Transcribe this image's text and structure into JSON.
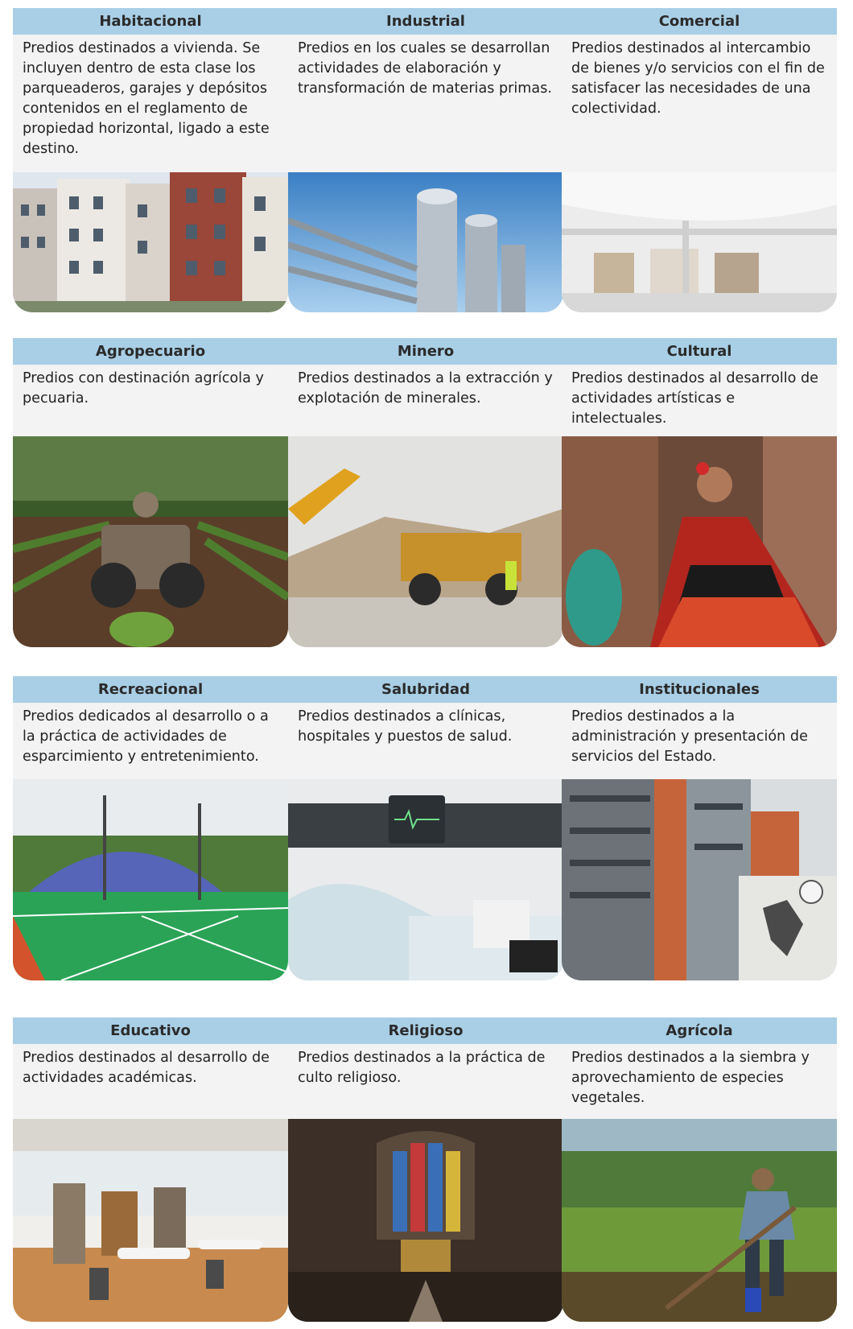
{
  "cards": [
    {
      "title": "Habitacional",
      "description": "Predios destinados a vivienda. Se incluyen dentro de esta clase los parqueaderos, garajes y depósitos contenidos en el reglamento de propiedad horizontal, ligado a este destino.",
      "image": "apartment-buildings-photo"
    },
    {
      "title": "Industrial",
      "description": "Predios en los cuales se desarrollan actividades de elaboración y transformación de materias primas.",
      "image": "industrial-tanks-photo"
    },
    {
      "title": "Comercial",
      "description": "Predios destinados al intercambio de bienes y/o servicios con el fin de satisfacer las necesidades de una colectividad.",
      "image": "shopping-mall-photo"
    },
    {
      "title": "Agropecuario",
      "description": "Predios con destinación agrícola y pecuaria.",
      "image": "tractor-field-photo"
    },
    {
      "title": "Minero",
      "description": "Predios destinados a la extracción y explotación de minerales.",
      "image": "mining-truck-photo"
    },
    {
      "title": "Cultural",
      "description": "Predios destinados al desarrollo de actividades artísticas e intelectuales.",
      "image": "folk-dancer-photo"
    },
    {
      "title": "Recreacional",
      "description": "Predios dedicados al desarrollo o a la práctica de actividades de esparcimiento y entretenimiento.",
      "image": "sports-court-photo"
    },
    {
      "title": "Salubridad",
      "description": "Predios destinados a clínicas, hospitales y puestos de salud.",
      "image": "hospital-bed-photo"
    },
    {
      "title": "Institucionales",
      "description": "Predios destinados a la administración y presentación de servicios del Estado.",
      "image": "government-building-photo"
    },
    {
      "title": "Educativo",
      "description": "Predios destinados al desarrollo de actividades académicas.",
      "image": "library-classroom-photo"
    },
    {
      "title": "Religioso",
      "description": "Predios destinados a la práctica de culto religioso.",
      "image": "church-interior-photo"
    },
    {
      "title": "Agrícola",
      "description": "Predios destinados a la siembra y aprovechamiento de especies vegetales.",
      "image": "farmer-hoe-photo"
    }
  ]
}
